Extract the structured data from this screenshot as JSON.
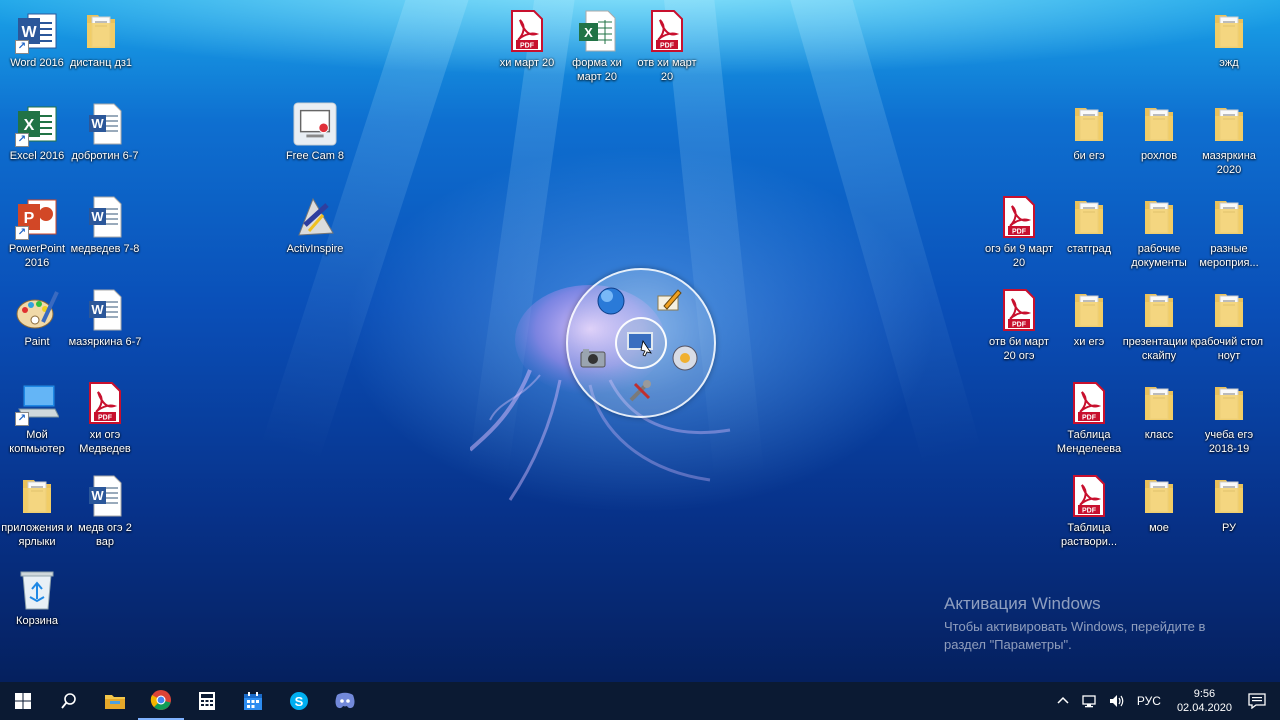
{
  "desktop_icons": [
    {
      "label": "Word 2016",
      "type": "word-app"
    },
    {
      "label": "дистанц дз1",
      "type": "folder"
    },
    {
      "label": "хи март 20",
      "type": "pdf"
    },
    {
      "label": "форма хи март 20",
      "type": "excel-file"
    },
    {
      "label": "отв хи март 20",
      "type": "pdf"
    },
    {
      "label": "эжд",
      "type": "folder"
    },
    {
      "label": "Excel 2016",
      "type": "excel-app"
    },
    {
      "label": "добротин 6-7",
      "type": "word-file"
    },
    {
      "label": "Free Cam 8",
      "type": "freecam"
    },
    {
      "label": "би егэ",
      "type": "folder"
    },
    {
      "label": "рохлов",
      "type": "folder"
    },
    {
      "label": "мазяркина 2020",
      "type": "folder"
    },
    {
      "label": "PowerPoint 2016",
      "type": "powerpoint-app"
    },
    {
      "label": "медведев 7-8",
      "type": "word-file"
    },
    {
      "label": "ActivInspire",
      "type": "activinspire"
    },
    {
      "label": "огэ би 9 март 20",
      "type": "pdf"
    },
    {
      "label": "статград",
      "type": "folder"
    },
    {
      "label": "рабочие документы",
      "type": "folder"
    },
    {
      "label": "разные мероприя...",
      "type": "folder"
    },
    {
      "label": "Paint",
      "type": "paint"
    },
    {
      "label": "мазяркина 6-7",
      "type": "word-file"
    },
    {
      "label": "отв би март 20 огэ",
      "type": "pdf"
    },
    {
      "label": "хи егэ",
      "type": "folder"
    },
    {
      "label": "презентации к скайпу",
      "type": "folder"
    },
    {
      "label": "рабочий стол ноут",
      "type": "folder"
    },
    {
      "label": "Мой копмьютер",
      "type": "computer"
    },
    {
      "label": "хи огэ Медведев",
      "type": "pdf"
    },
    {
      "label": "Таблица Менделеева",
      "type": "pdf"
    },
    {
      "label": "класс",
      "type": "folder"
    },
    {
      "label": "учеба егэ 2018-19",
      "type": "folder"
    },
    {
      "label": "приложения и ярлыки",
      "type": "folder"
    },
    {
      "label": "медв огэ 2 вар",
      "type": "word-file"
    },
    {
      "label": "Таблица раствори...",
      "type": "pdf"
    },
    {
      "label": "мое",
      "type": "folder"
    },
    {
      "label": "РУ",
      "type": "folder"
    },
    {
      "label": "Корзина",
      "type": "recycle-bin"
    }
  ],
  "radial_menu": {
    "items": [
      "globe-icon",
      "pen-icon",
      "screen-capture-icon",
      "camera-icon",
      "tools-icon",
      "disc-icon"
    ]
  },
  "activation": {
    "title": "Активация Windows",
    "line1": "Чтобы активировать Windows, перейдите в",
    "line2": "раздел \"Параметры\"."
  },
  "taskbar": {
    "apps": [
      "windows-start-icon",
      "search-icon",
      "file-explorer-icon",
      "chrome-icon",
      "calculator-icon",
      "calendar-icon",
      "skype-icon",
      "discord-icon"
    ],
    "language": "РУС",
    "time": "9:56",
    "date": "02.04.2020"
  }
}
